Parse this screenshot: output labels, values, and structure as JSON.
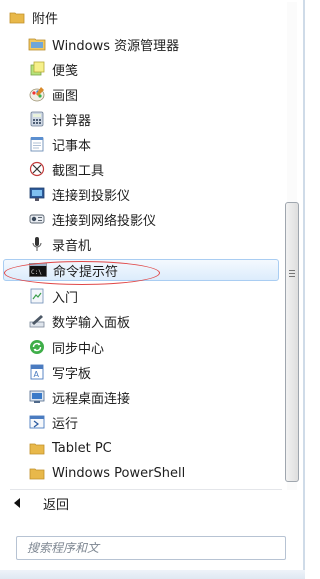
{
  "menu": {
    "folder_label": "附件",
    "items": [
      {
        "label": "Windows 资源管理器",
        "icon": "windows-explorer-icon"
      },
      {
        "label": "便笺",
        "icon": "sticky-notes-icon"
      },
      {
        "label": "画图",
        "icon": "paint-icon"
      },
      {
        "label": "计算器",
        "icon": "calculator-icon"
      },
      {
        "label": "记事本",
        "icon": "notepad-icon"
      },
      {
        "label": "截图工具",
        "icon": "snipping-tool-icon"
      },
      {
        "label": "连接到投影仪",
        "icon": "projector-icon"
      },
      {
        "label": "连接到网络投影仪",
        "icon": "network-projector-icon"
      },
      {
        "label": "录音机",
        "icon": "sound-recorder-icon"
      },
      {
        "label": "命令提示符",
        "icon": "command-prompt-icon"
      },
      {
        "label": "入门",
        "icon": "getting-started-icon"
      },
      {
        "label": "数学输入面板",
        "icon": "math-input-icon"
      },
      {
        "label": "同步中心",
        "icon": "sync-center-icon"
      },
      {
        "label": "写字板",
        "icon": "wordpad-icon"
      },
      {
        "label": "远程桌面连接",
        "icon": "remote-desktop-icon"
      },
      {
        "label": "运行",
        "icon": "run-icon"
      },
      {
        "label": "Tablet PC",
        "icon": "folder-icon"
      },
      {
        "label": "Windows PowerShell",
        "icon": "folder-icon"
      }
    ],
    "back_label": "返回"
  },
  "search": {
    "placeholder": "搜索程序和文"
  },
  "colors": {
    "highlight_border": "#a9cdf2",
    "annotation_ellipse": "#e04848",
    "folder": "#e8b84a"
  }
}
